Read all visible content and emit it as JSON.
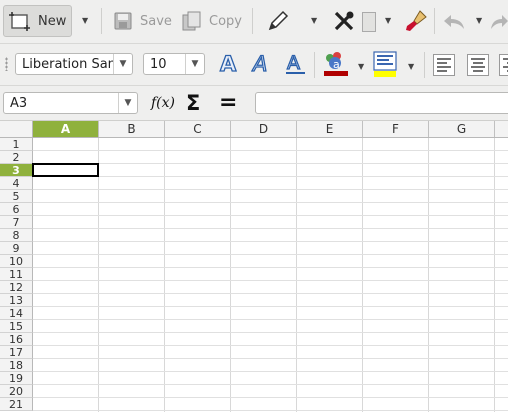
{
  "toolbar": {
    "new_label": "New",
    "save_label": "Save",
    "copy_label": "Copy"
  },
  "format": {
    "font_name": "Liberation San",
    "font_size": "10"
  },
  "formula": {
    "name_box": "A3",
    "function_wizard_label": "f(x)",
    "sum_label": "Σ",
    "equals_label": "=",
    "input_value": ""
  },
  "sheet": {
    "columns": [
      "A",
      "B",
      "C",
      "D",
      "E",
      "F",
      "G"
    ],
    "rows": [
      "1",
      "2",
      "3",
      "4",
      "5",
      "6",
      "7",
      "8",
      "9",
      "10",
      "11",
      "12",
      "13",
      "14",
      "15",
      "16",
      "17",
      "18",
      "19",
      "20",
      "21"
    ],
    "selected_column": "A",
    "selected_row": "3"
  },
  "colors": {
    "selection_header": "#8fb13d",
    "font_color": "#b00000",
    "highlight_color": "#ffff00"
  }
}
